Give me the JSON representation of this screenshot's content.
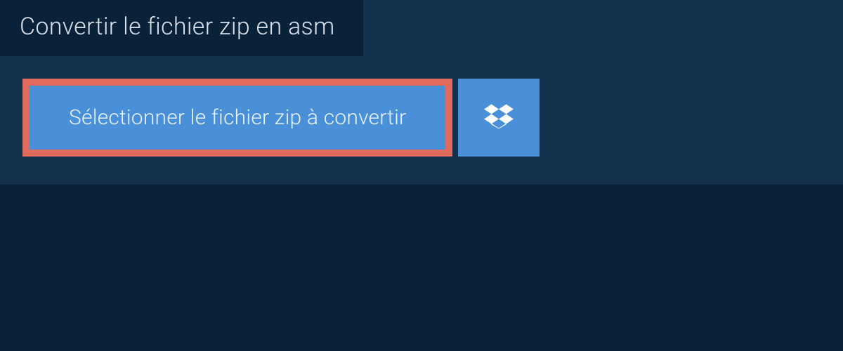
{
  "title": "Convertir le fichier zip en asm",
  "selectButton": {
    "label": "Sélectionner le fichier zip à convertir"
  },
  "colors": {
    "background": "#0a2239",
    "panel": "#14324d",
    "buttonBg": "#4990d9",
    "highlightBorder": "#e06a5b",
    "textLight": "#d8e1ea"
  }
}
